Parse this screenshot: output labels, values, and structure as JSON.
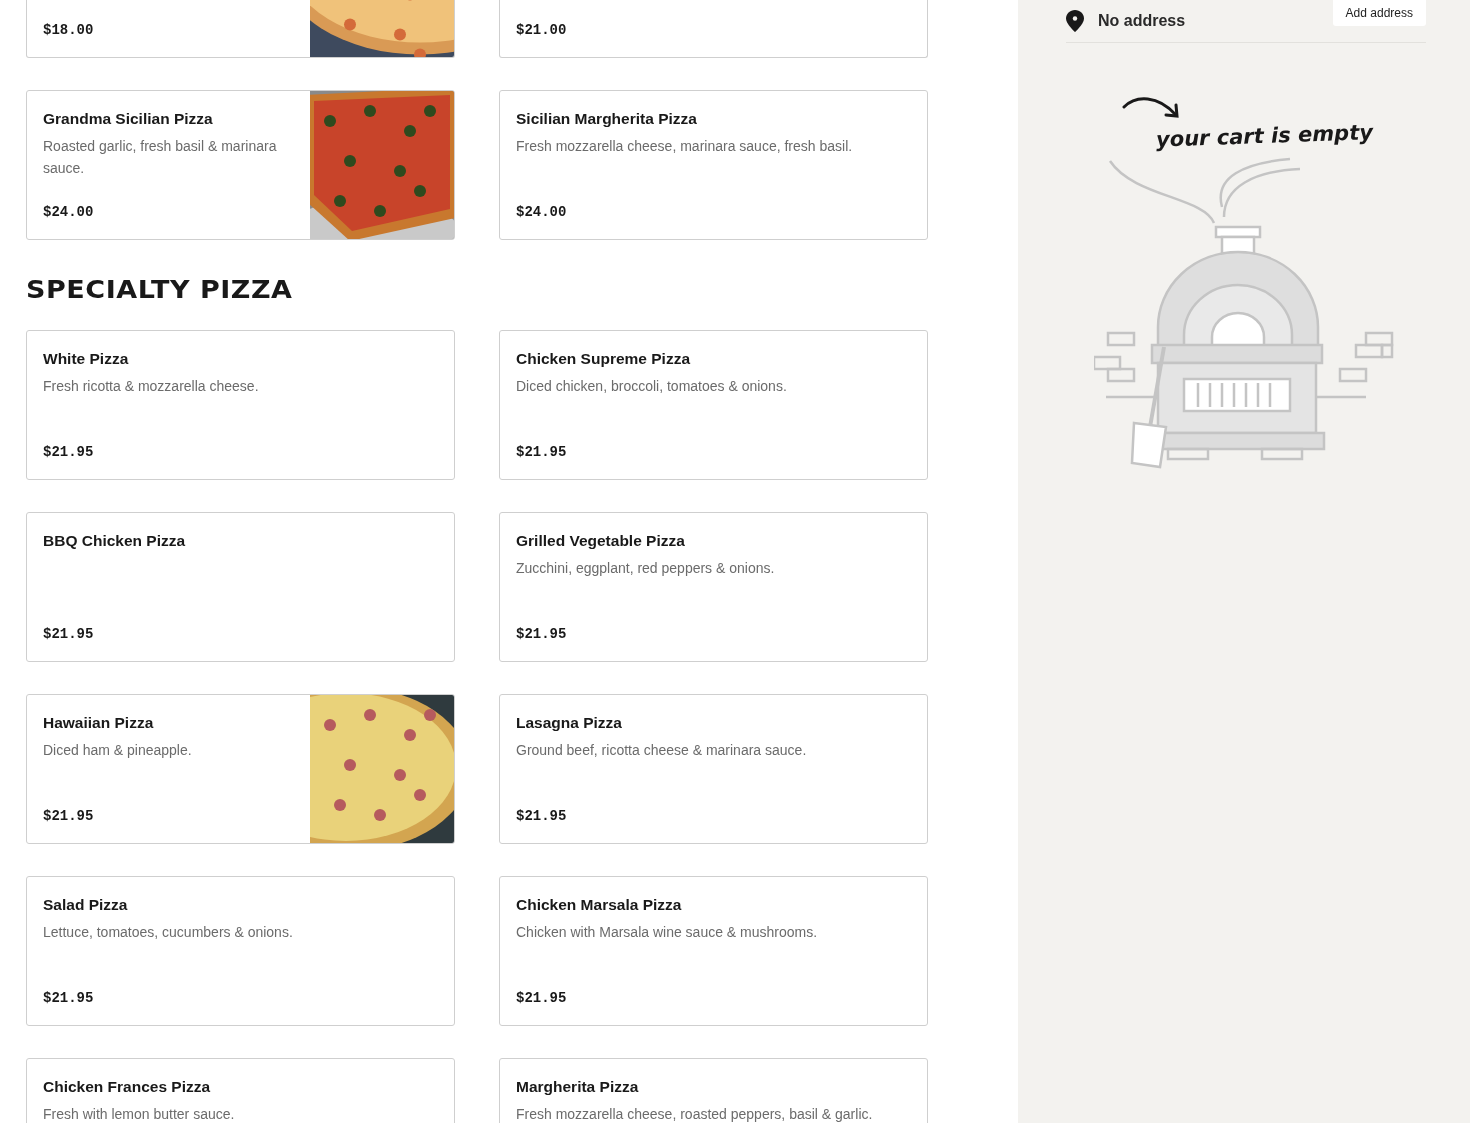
{
  "sections": [
    {
      "items": [
        {
          "price": "$18.00"
        },
        {
          "price": "$21.00"
        },
        {
          "name": "Grandma Sicilian Pizza",
          "description": "Roasted garlic, fresh basil & marinara sauce.",
          "price": "$24.00"
        },
        {
          "name": "Sicilian Margherita Pizza",
          "description": "Fresh mozzarella cheese, marinara sauce, fresh basil.",
          "price": "$24.00"
        }
      ]
    },
    {
      "title": "SPECIALTY PIZZA",
      "items": [
        {
          "name": "White Pizza",
          "description": "Fresh ricotta & mozzarella cheese.",
          "price": "$21.95"
        },
        {
          "name": "Chicken Supreme Pizza",
          "description": "Diced chicken, broccoli, tomatoes & onions.",
          "price": "$21.95"
        },
        {
          "name": "BBQ Chicken Pizza",
          "price": "$21.95"
        },
        {
          "name": "Grilled Vegetable Pizza",
          "description": "Zucchini, eggplant, red peppers & onions.",
          "price": "$21.95"
        },
        {
          "name": "Hawaiian Pizza",
          "description": "Diced ham & pineapple.",
          "price": "$21.95"
        },
        {
          "name": "Lasagna Pizza",
          "description": "Ground beef, ricotta cheese & marinara sauce.",
          "price": "$21.95"
        },
        {
          "name": "Salad Pizza",
          "description": "Lettuce, tomatoes, cucumbers & onions.",
          "price": "$21.95"
        },
        {
          "name": "Chicken Marsala Pizza",
          "description": "Chicken with Marsala wine sauce & mushrooms.",
          "price": "$21.95"
        },
        {
          "name": "Chicken Frances Pizza",
          "description": "Fresh with lemon butter sauce."
        },
        {
          "name": "Margherita Pizza",
          "description": "Fresh mozzarella cheese, roasted peppers, basil & garlic."
        }
      ]
    }
  ],
  "cart": {
    "address": "No address",
    "add_button": "Add address",
    "empty_message": "your cart is empty"
  }
}
